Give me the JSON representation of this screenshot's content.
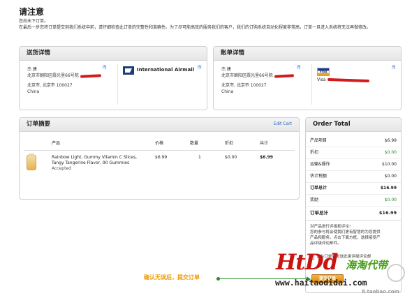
{
  "page": {
    "title": "请注意",
    "intro_line1": "您尚未下订单。",
    "intro_line2": "在最后一步您将订单提交到我们系统中前，请仔细检查此订单的完整性和准确性。为了尽可能高效的服务我们的客户，我们的订购系统自动化程度非常高，订单一旦进入系统将无法再做修改。"
  },
  "shipping": {
    "title": "送货详情",
    "name": "杰 唐",
    "street": "北京市朝阳区霞光里66号院",
    "city_line": "北京市, 北京市 100027",
    "country": "China",
    "change_address": "改",
    "method_icon": "usps-eagle-icon",
    "method": "International Airmail",
    "change_method": "改"
  },
  "billing": {
    "title": "账单详情",
    "name": "杰 唐",
    "street": "北京市朝阳区霞光里66号院",
    "city_line": "北京市, 北京市 100027",
    "country": "China",
    "change_address": "改",
    "card_icon": "visa-card-icon",
    "card_label": "VISA",
    "card_type": "Visa",
    "change_payment": "改"
  },
  "summary": {
    "title": "订单摘要",
    "edit_cart": "Edit Cart",
    "columns": {
      "product": "产品",
      "price": "价格",
      "qty": "数量",
      "discount": "折扣",
      "total": "共计"
    },
    "items": [
      {
        "name": "Rainbow Light, Gummy Vitamin C Slices, Tangy Tangerine Flavor, 90 Gummies",
        "status": "Accepted",
        "price": "$6.99",
        "qty": "1",
        "discount": "$0.00",
        "total": "$6.99"
      }
    ]
  },
  "order_total": {
    "title": "Order Total",
    "rows": [
      {
        "label": "产品项目",
        "value": "$6.99",
        "style": ""
      },
      {
        "label": "折扣",
        "value": "$0.00",
        "style": "green"
      },
      {
        "label": "运输&操作",
        "value": "$10.00",
        "style": ""
      },
      {
        "label": "估计税额",
        "value": "$0.00",
        "style": ""
      },
      {
        "label": "订单总计",
        "value": "$16.99",
        "style": "bold"
      },
      {
        "label": "奖励",
        "value": "$0.00",
        "style": "green"
      }
    ],
    "final_label": "订单总计",
    "final_value": "$16.99",
    "note_lines": [
      "对产品进行评级和评论!",
      "您的参与将会使我们更有智慧的为您提供",
      "产品和服务。点击下面方框，选择接受产",
      "品评级评论邮件。"
    ],
    "checkbox_label": "请在订单后发送此类评级评论邮",
    "submit_label": "提交订单"
  },
  "annotation": {
    "text": "确认无误后，提交订单",
    "color": "#f09a00",
    "line_color": "#2e8a2a"
  },
  "watermark": {
    "brand": "HtDd",
    "chinese": "海淘代带",
    "url": "www.haitaodidai.com",
    "small": "8.taobao.com"
  }
}
